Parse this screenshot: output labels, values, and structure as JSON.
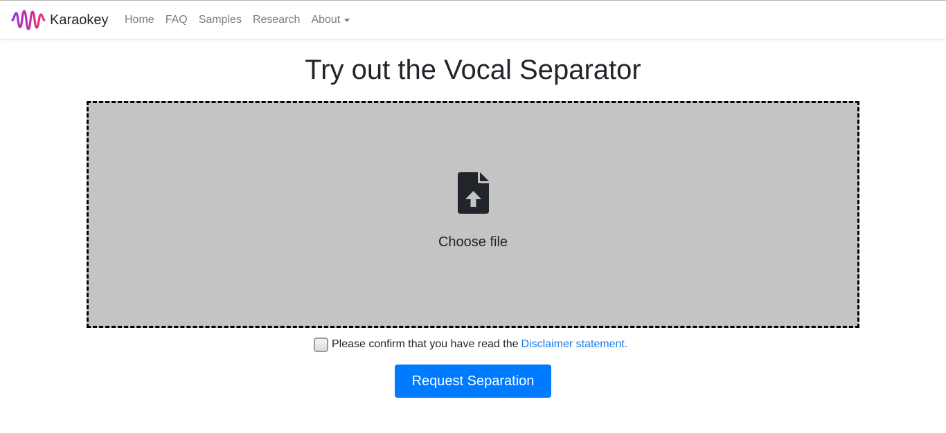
{
  "navbar": {
    "brand_name": "Karaokey",
    "logo_icon": "waveform-logo-icon",
    "links": [
      {
        "label": "Home"
      },
      {
        "label": "FAQ"
      },
      {
        "label": "Samples"
      },
      {
        "label": "Research"
      },
      {
        "label": "About",
        "dropdown": true
      }
    ]
  },
  "main": {
    "title": "Try out the Vocal Separator",
    "dropzone": {
      "icon": "file-upload-icon",
      "label": "Choose file"
    },
    "confirm": {
      "checked": false,
      "text": "Please confirm that you have read the",
      "link_text": "Disclaimer statement."
    },
    "submit_label": "Request Separation"
  },
  "colors": {
    "primary": "#007bff",
    "link": "#1a7be6",
    "dropzone_bg": "#c4c4c4",
    "logo_gradient_start": "#a02bd6",
    "logo_gradient_end": "#e53970"
  }
}
